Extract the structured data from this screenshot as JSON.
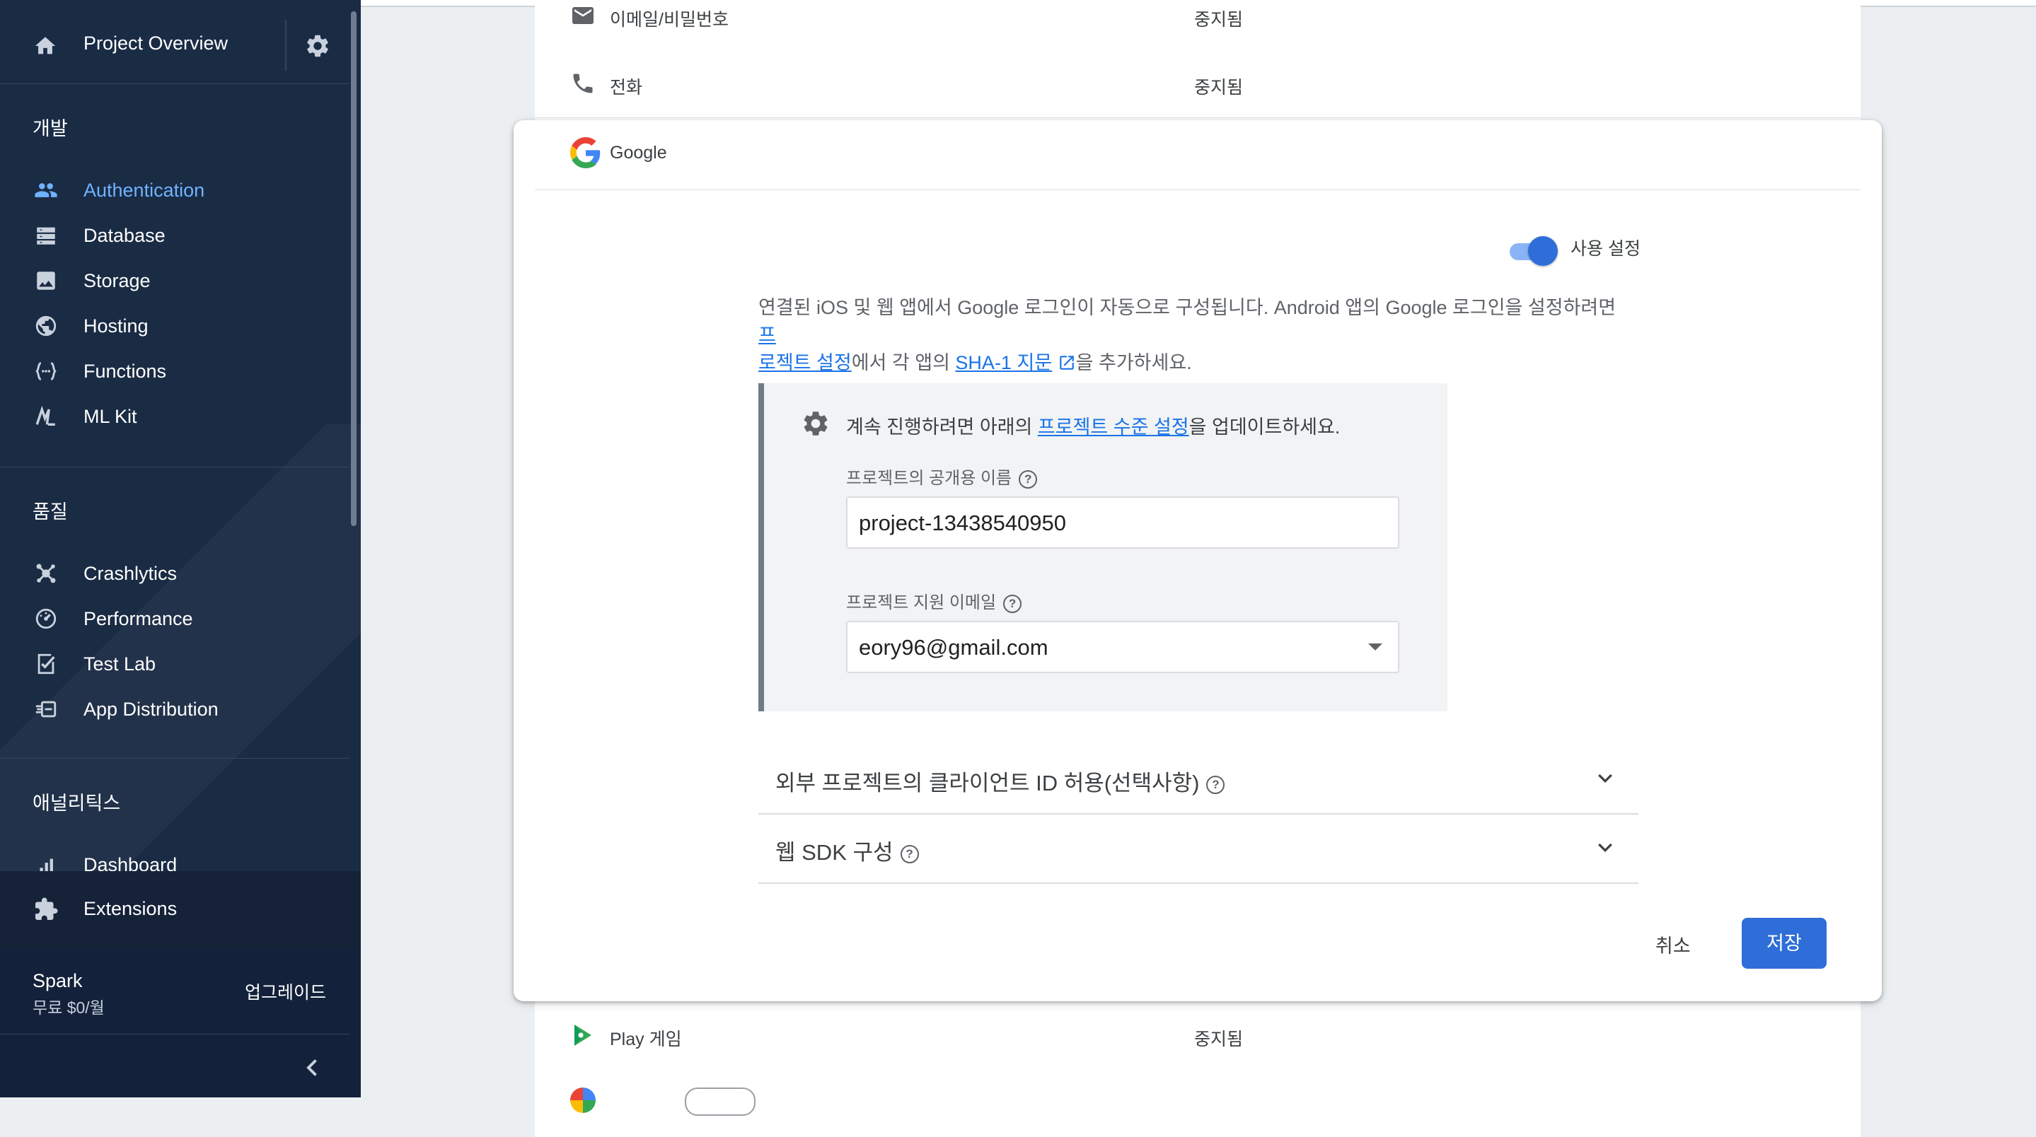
{
  "sidebar": {
    "header": {
      "title": "Project Overview"
    },
    "sections": {
      "develop": "개발",
      "quality": "품질",
      "analytics": "애널리틱스"
    },
    "develop_items": [
      {
        "label": "Authentication",
        "icon": "people-icon",
        "active": true
      },
      {
        "label": "Database",
        "icon": "database-icon"
      },
      {
        "label": "Storage",
        "icon": "storage-icon"
      },
      {
        "label": "Hosting",
        "icon": "globe-icon"
      },
      {
        "label": "Functions",
        "icon": "functions-icon"
      },
      {
        "label": "ML Kit",
        "icon": "ml-kit-icon"
      }
    ],
    "quality_items": [
      {
        "label": "Crashlytics",
        "icon": "crashlytics-icon"
      },
      {
        "label": "Performance",
        "icon": "performance-icon"
      },
      {
        "label": "Test Lab",
        "icon": "test-lab-icon"
      },
      {
        "label": "App Distribution",
        "icon": "app-distribution-icon"
      }
    ],
    "analytics_items": [
      {
        "label": "Dashboard",
        "icon": "bar-chart-icon"
      }
    ],
    "extensions": {
      "label": "Extensions",
      "icon": "puzzle-icon"
    },
    "plan": {
      "name": "Spark",
      "price": "무료 $0/월",
      "upgrade": "업그레이드"
    }
  },
  "providers": {
    "email": {
      "name": "이메일/비밀번호",
      "status": "중지됨"
    },
    "phone": {
      "name": "전화",
      "status": "중지됨"
    },
    "play": {
      "name": "Play 게임",
      "status": "중지됨"
    }
  },
  "google_card": {
    "title": "Google",
    "enable_label": "사용 설정",
    "enabled": true,
    "description": {
      "part1": "연결된 iOS 및 웹 앱에서 Google 로그인이 자동으로 구성됩니다. Android 앱의 Google 로그인을 설정하려면 ",
      "link1a": "프",
      "link1b": "로젝트 설정",
      "part2": "에서 각 앱의 ",
      "link2": "SHA-1 지문",
      "part3": "을 추가하세요."
    },
    "notice": {
      "pre": "계속 진행하려면 아래의 ",
      "link": "프로젝트 수준 설정",
      "post": "을 업데이트하세요."
    },
    "public_name": {
      "label": "프로젝트의 공개용 이름",
      "value": "project-13438540950"
    },
    "support_email": {
      "label": "프로젝트 지원 이메일",
      "value": "eory96@gmail.com"
    },
    "expanders": [
      {
        "label": "외부 프로젝트의 클라이언트 ID 허용(선택사항)"
      },
      {
        "label": "웹 SDK 구성"
      }
    ],
    "help_glyph": "?",
    "cancel": "취소",
    "save": "저장"
  },
  "colors": {
    "sidebar_bg": "#1a2b44",
    "accent": "#2f6ed8",
    "active_nav": "#6fb2ff"
  }
}
